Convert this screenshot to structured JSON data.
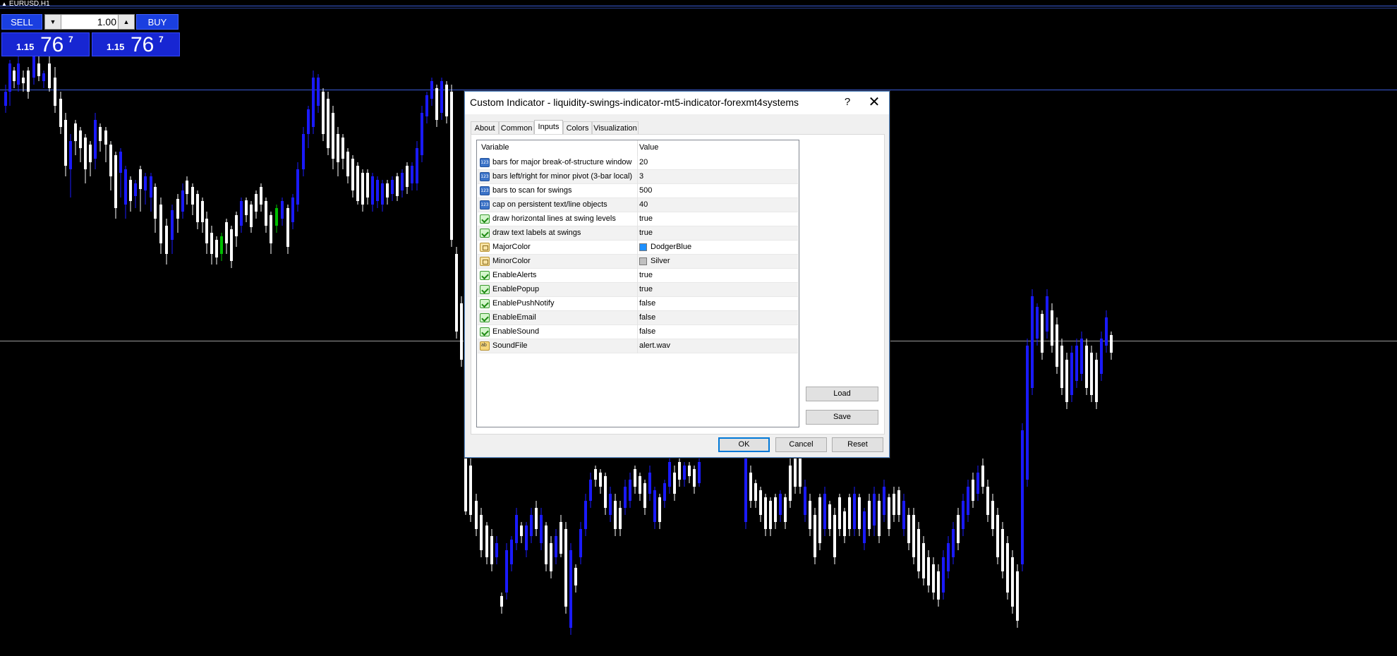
{
  "chart": {
    "symbol_title": "EURUSD,H1",
    "line_colors": {
      "upper": "#3a5bd8",
      "lower": "#b8b8b8",
      "top": "#3a5bd8"
    },
    "candle_colors": {
      "bull": "#1a1aff",
      "bear": "#ffffff",
      "neutral": "#00c000"
    }
  },
  "trade_panel": {
    "sell_label": "SELL",
    "buy_label": "BUY",
    "lot_value": "1.00",
    "lot_down_icon": "arrow-down-icon",
    "lot_up_icon": "arrow-up-icon",
    "bid": {
      "prefix": "1.15",
      "big": "76",
      "sup": "7"
    },
    "ask": {
      "prefix": "1.15",
      "big": "76",
      "sup": "7"
    }
  },
  "dialog": {
    "title": "Custom Indicator - liquidity-swings-indicator-mt5-indicator-forexmt4systems",
    "help_label": "?",
    "close_label": "✕",
    "tabs": [
      "About",
      "Common",
      "Inputs",
      "Colors",
      "Visualization"
    ],
    "active_tab": "Inputs",
    "columns": {
      "variable": "Variable",
      "value": "Value"
    },
    "params": [
      {
        "icon": "number-icon",
        "name": "bars for major break-of-structure window",
        "value": "20"
      },
      {
        "icon": "number-icon",
        "name": "bars left/right for minor pivot (3-bar local)",
        "value": "3"
      },
      {
        "icon": "number-icon",
        "name": "bars to scan for swings",
        "value": "500"
      },
      {
        "icon": "number-icon",
        "name": "cap on persistent text/line objects",
        "value": "40"
      },
      {
        "icon": "bool-icon",
        "name": "draw horizontal lines at swing levels",
        "value": "true"
      },
      {
        "icon": "bool-icon",
        "name": "draw text labels at swings",
        "value": "true"
      },
      {
        "icon": "color-icon",
        "name": "MajorColor",
        "value": "DodgerBlue",
        "swatch": "#1e90ff"
      },
      {
        "icon": "color-icon",
        "name": "MinorColor",
        "value": "Silver",
        "swatch": "#c0c0c0"
      },
      {
        "icon": "bool-icon",
        "name": "EnableAlerts",
        "value": "true"
      },
      {
        "icon": "bool-icon",
        "name": "EnablePopup",
        "value": "true"
      },
      {
        "icon": "bool-icon",
        "name": "EnablePushNotify",
        "value": "false"
      },
      {
        "icon": "bool-icon",
        "name": "EnableEmail",
        "value": "false"
      },
      {
        "icon": "bool-icon",
        "name": "EnableSound",
        "value": "false"
      },
      {
        "icon": "string-icon",
        "name": "SoundFile",
        "value": "alert.wav"
      }
    ],
    "buttons": {
      "load": "Load",
      "save": "Save",
      "ok": "OK",
      "cancel": "Cancel",
      "reset": "Reset"
    }
  }
}
